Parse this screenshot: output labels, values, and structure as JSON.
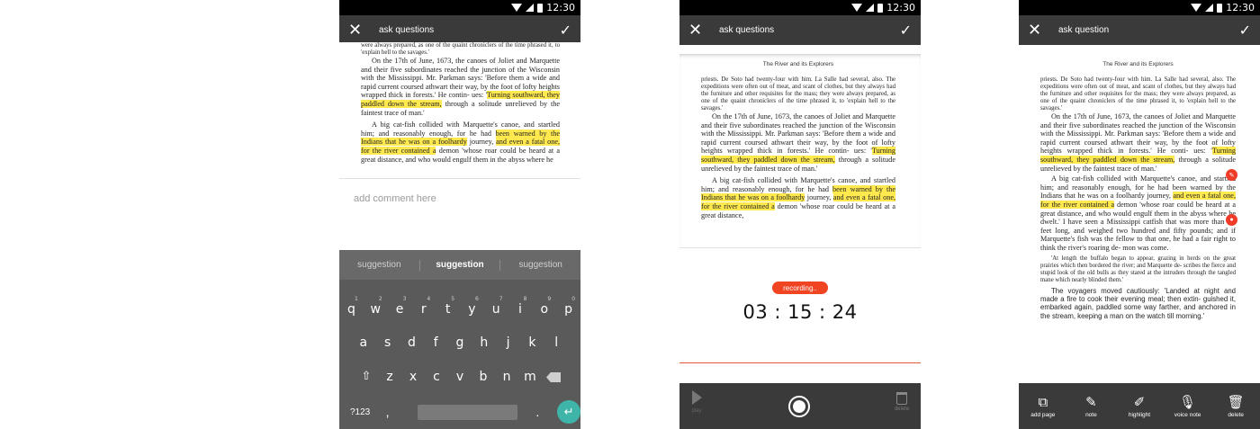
{
  "status": {
    "time": "12:30"
  },
  "screen1": {
    "title": "ask questions",
    "doc": {
      "top": "were always prepared, as one of the quaint chroniclers of the time phrased it, to 'explain hell to the savages.'",
      "p1a": "On the 17th of June, 1673, the canoes of Joliet and Marquette and their five subordinates reached the junction of the Wisconsin with the Mississippi. Mr. Parkman says: 'Before them a wide and rapid current coursed athwart their way, by the foot of lofty heights wrapped thick in forests.' He contin- ues: '",
      "p1hl": "Turning southward, they paddled down the stream,",
      "p1b": " through a solitude unrelieved by the faintest trace of man.'",
      "p2a": "A big cat-fish collided with Marquette's canoe, and startled him; and reasonably enough, for he had ",
      "p2hl1": "been warned by the Indians that he was on a foolhardy",
      "p2b": " journey, ",
      "p2hl2": "and even a fatal one, for the river contained a",
      "p2c": " demon 'whose roar could be heard at a great distance, and who would engulf them in the abyss where he"
    },
    "comment_placeholder": "add comment here",
    "keyboard": {
      "suggestions": [
        "suggestion",
        "suggestion",
        "suggestion"
      ],
      "row1": [
        "q",
        "w",
        "e",
        "r",
        "t",
        "y",
        "u",
        "i",
        "o",
        "p"
      ],
      "row1_nums": [
        "1",
        "2",
        "3",
        "4",
        "5",
        "6",
        "7",
        "8",
        "9",
        "0"
      ],
      "row2": [
        "a",
        "s",
        "d",
        "f",
        "g",
        "h",
        "j",
        "k",
        "l"
      ],
      "row3": [
        "z",
        "x",
        "c",
        "v",
        "b",
        "n",
        "m"
      ],
      "shift": "⇧",
      "key_123": "?123",
      "comma": ",",
      "period": ".",
      "enter": "↵"
    }
  },
  "screen2": {
    "title": "ask questions",
    "doc": {
      "book_title": "The River and its Explorers",
      "top": "priests. De Soto had twenty-four with him. La Salle had several, also. The expeditions were often out of meat, and scant of clothes, but they always had the furniture and other requisites for the mass; they were always prepared, as one of the quaint chroniclers of the time phrased it, to 'explain hell to the savages.'",
      "p1a": "On the 17th of June, 1673, the canoes of Joliet and Marquette and their five subordinates reached the junction of the Wisconsin with the Mississippi. Mr. Parkman says: 'Before them a wide and rapid current coursed athwart their way, by the foot of lofty heights wrapped thick in forests.' He contin- ues: '",
      "p1hl": "Turning southward, they paddled down the stream,",
      "p1b": " through a solitude unrelieved by the faintest trace of man.'",
      "p2a": "A big cat-fish collided with Marquette's canoe, and startled him; and reasonably enough, for he had ",
      "p2hl1": "been warned by the Indians that he was on a foolhardy",
      "p2b": " journey, ",
      "p2hl2": "and even a fatal one, for the river contained a",
      "p2c": " demon 'whose roar could be heard at a great distance,"
    },
    "recording_label": "recording..",
    "timer": "03 : 15 : 24",
    "play_label": "play",
    "delete_label": "delete"
  },
  "screen3": {
    "title": "ask question",
    "doc": {
      "book_title": "The River and its Explorers",
      "top": "priests. De Soto had twenty-four with him. La Salle had several, also. The expeditions were often out of meat, and scant of clothes, but they always had the furniture and other requisites for the mass; they were always prepared, as one of the quaint chroniclers of the time phrased it, to 'explain hell to the savages.'",
      "p1a": "On the 17th of June, 1673, the canoes of Joliet and Marquette and their five subordinates reached the junction of the Wisconsin with the Mississippi. Mr. Parkman says: 'Before them a wide and rapid current coursed athwart their way, by the foot of lofty heights wrapped thick in forests.' He conti- ues: '",
      "p1hl": "Turning southward, they paddled down the stream,",
      "p1b": " through a solitude unrelieved by the faintest trace of man.'",
      "p2a": "A big cat-fish collided with Marquette's canoe, and startled him; and reasonably enough, for he had been warned by the Indians that he was on a foolhardy journey, ",
      "p2hl": "and even a fatal one, for the river contained a",
      "p2b": " demon 'whose roar could be heard at a great distance, and who would engulf them in the abyss where he dwelt.' I have seen a Mississippi catfish that was more than six feet long, and weighed two hundred and fifty pounds; and if Marquette's fish was the fellow to that one, he had a fair right to think the river's roaring de- mon was come.",
      "note": "'At length the buffalo began to appear, grazing in herds on the great prairies which then bordered the river; and Marquette de- scribes the fierce and stupid look of the old bulls as they stared at the intruders through the tangled mane which nearly blinded them.'",
      "p3": "The voyagers moved cautiously: 'Landed at night and made a fire to cook their evening meal; then extin- guished it, embarked again, paddled some way farther, and anchored in the stream, keeping a man on the watch till morning.'"
    },
    "tools": [
      {
        "label": "add page",
        "icon": "add-page-icon",
        "glyph": "⧉"
      },
      {
        "label": "note",
        "icon": "pencil-icon",
        "glyph": "✎"
      },
      {
        "label": "highlight",
        "icon": "highlighter-icon",
        "glyph": "✐"
      },
      {
        "label": "voice note",
        "icon": "microphone-icon",
        "glyph": "🎙"
      },
      {
        "label": "delete",
        "icon": "trash-icon",
        "glyph": "🗑"
      }
    ]
  },
  "colors": {
    "highlight": "#ffe94f",
    "accent_red": "#ef3c29",
    "appbar": "#3a3a3a",
    "enter_key": "#3fb5a9"
  }
}
